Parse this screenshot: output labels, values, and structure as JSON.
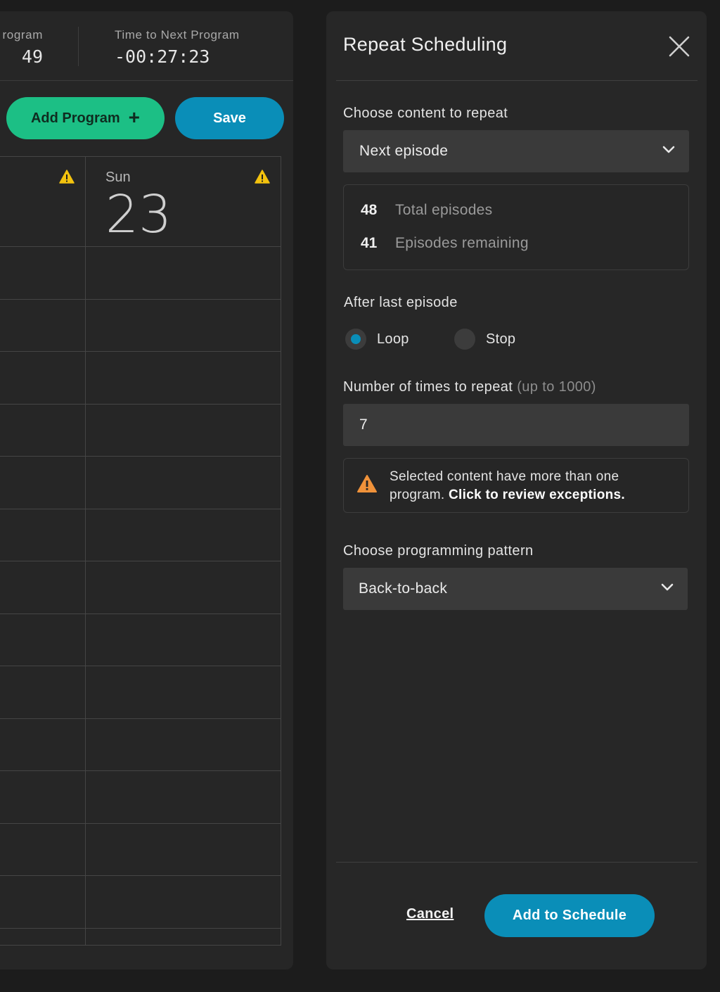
{
  "schedule": {
    "current_program_label": "rogram",
    "current_program_value": "49",
    "next_program_label": "Time to Next Program",
    "next_program_value": "-00:27:23",
    "add_program_label": "Add Program",
    "save_label": "Save",
    "day_name": "Sun",
    "day_number": "23"
  },
  "modal": {
    "title": "Repeat Scheduling",
    "content_label": "Choose content to repeat",
    "content_selected": "Next episode",
    "stats": [
      {
        "value": "48",
        "label": "Total episodes"
      },
      {
        "value": "41",
        "label": "Episodes remaining"
      }
    ],
    "after_label": "After last episode",
    "options": [
      {
        "label": "Loop",
        "checked": true
      },
      {
        "label": "Stop",
        "checked": false
      }
    ],
    "repeat_label": "Number of times to repeat",
    "repeat_hint": "(up to 1000)",
    "repeat_value": "7",
    "alert_text": "Selected content have more than one program.",
    "alert_link": "Click to review exceptions.",
    "pattern_label": "Choose programming pattern",
    "pattern_selected": "Back-to-back",
    "cancel_label": "Cancel",
    "submit_label": "Add to Schedule"
  },
  "colors": {
    "accent_blue": "#0a8eb8",
    "accent_green": "#1cbf85",
    "warning_yellow": "#f3c20e",
    "warning_orange": "#f0923a"
  },
  "icons": [
    "warning-icon",
    "close-icon",
    "chevron-down-icon",
    "plus-icon"
  ]
}
